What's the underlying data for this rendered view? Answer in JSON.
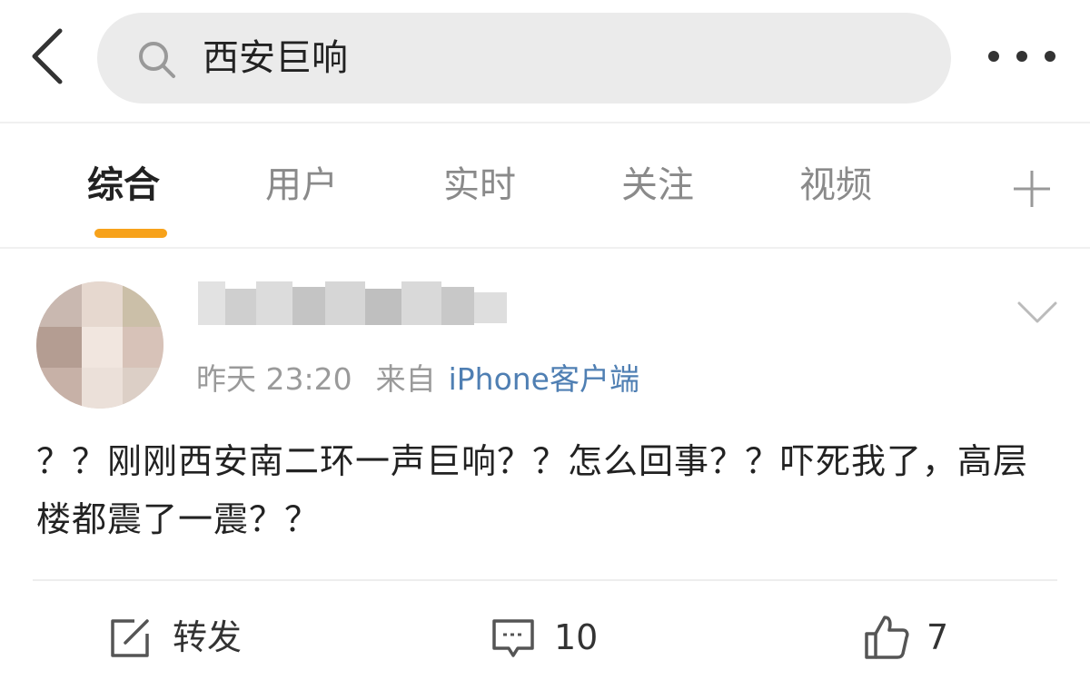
{
  "search": {
    "query": "西安巨响"
  },
  "tabs": [
    {
      "label": "综合",
      "active": true
    },
    {
      "label": "用户",
      "active": false
    },
    {
      "label": "实时",
      "active": false
    },
    {
      "label": "关注",
      "active": false
    },
    {
      "label": "视频",
      "active": false
    }
  ],
  "icons": {
    "back": "chevron-left-icon",
    "search": "search-icon",
    "more": "more-dots-icon",
    "add_tab": "plus-icon",
    "post_menu": "chevron-down-icon",
    "repost": "share-icon",
    "comment": "comment-icon",
    "like": "thumbs-up-icon"
  },
  "colors": {
    "accent": "#f7a21b",
    "link": "#4f7fb3",
    "search_bg": "#ebebeb"
  },
  "post": {
    "time": "昨天 23:20",
    "source_prefix": "来自",
    "client": "iPhone客户端",
    "text": "？？刚刚西安南二环一声巨响？？怎么回事？？吓死我了，高层楼都震了一震？？",
    "actions": {
      "repost_label": "转发",
      "comment_count": "10",
      "like_count": "7"
    }
  }
}
